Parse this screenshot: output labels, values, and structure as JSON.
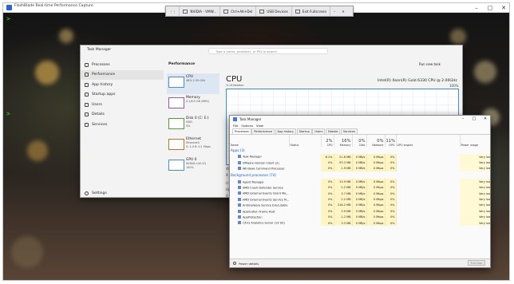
{
  "outer": {
    "title": "FlashBlade Real-time Performance Capture"
  },
  "vmbar": {
    "items": [
      "NVIDIA - VMW...",
      "Ctrl+Alt+Del",
      "USB Devices",
      "Exit Fullscreen"
    ]
  },
  "prompts": [
    ">",
    ">"
  ],
  "tm": {
    "title": "Task Manager",
    "search_placeholder": "Type a name, publisher, or PID to search",
    "nav": [
      {
        "label": "Processes",
        "icon": "grid-icon"
      },
      {
        "label": "Performance",
        "icon": "performance-icon"
      },
      {
        "label": "App history",
        "icon": "history-icon"
      },
      {
        "label": "Startup apps",
        "icon": "startup-icon"
      },
      {
        "label": "Users",
        "icon": "users-icon"
      },
      {
        "label": "Details",
        "icon": "details-icon"
      },
      {
        "label": "Services",
        "icon": "services-icon"
      }
    ],
    "settings": "Settings",
    "section": "Performance",
    "run_new_task": "Run new task",
    "cards": [
      {
        "name": "CPU",
        "sub": "46% 2.00 GHz"
      },
      {
        "name": "Memory",
        "sub": "4.1/6.0 GB (68%)"
      },
      {
        "name": "Disk 0 (C: E:)",
        "sub": "HDD\n0%"
      },
      {
        "name": "Ethernet",
        "sub": "Ethernet0\nS: 1.0 R: 0.1 Mbps"
      },
      {
        "name": "GPU 0",
        "sub": "NVIDIA L40-2Q\n100%"
      }
    ],
    "cpu_title": "CPU",
    "cpu_sub": "% Utilization",
    "cpu_name": "Intel(R) Xeon(R) Gold 6330 CPU @ 2.00GHz",
    "cpu_max": "100%",
    "side_stats": [
      "46",
      "9",
      "U",
      "Up",
      "0"
    ]
  },
  "tm2": {
    "title": "Task Manager",
    "menu": [
      "File",
      "Options",
      "View"
    ],
    "tabs": [
      "Processes",
      "Performance",
      "App history",
      "Startup",
      "Users",
      "Details",
      "Services"
    ],
    "columns": [
      {
        "label": "Name",
        "pct": ""
      },
      {
        "label": "Status",
        "pct": ""
      },
      {
        "label": "CPU",
        "pct": "2%"
      },
      {
        "label": "Memory",
        "pct": "16%"
      },
      {
        "label": "Disk",
        "pct": "0%"
      },
      {
        "label": "Network",
        "pct": "0%"
      },
      {
        "label": "GPU",
        "pct": "11%"
      },
      {
        "label": "GPU engine",
        "pct": ""
      },
      {
        "label": "Power usage",
        "pct": ""
      }
    ],
    "groups": [
      {
        "title": "Apps (3)",
        "rows": [
          {
            "name": "Task Manager",
            "cpu": "6.1%",
            "mem": "21.6 MB",
            "disk": "0 MB/s",
            "net": "0 Mbps",
            "gpu": "0%",
            "power": "Very low"
          },
          {
            "name": "VMware Horizon Client (2)",
            "cpu": "0%",
            "mem": "93.3 MB",
            "disk": "0 MB/s",
            "net": "0 Mbps",
            "gpu": "0%",
            "power": "Very low"
          },
          {
            "name": "Windows Command Processor",
            "cpu": "0%",
            "mem": "1.9 MB",
            "disk": "0 MB/s",
            "net": "0 Mbps",
            "gpu": "0%",
            "power": "Very low"
          }
        ]
      },
      {
        "title": "Background processes (74)",
        "rows": [
          {
            "name": "Agent Manager",
            "cpu": "0%",
            "mem": "13.9 MB",
            "disk": "0 MB/s",
            "net": "0 Mbps",
            "gpu": "0%",
            "power": "Very low"
          },
          {
            "name": "AMD Crash Defender Service",
            "cpu": "0%",
            "mem": "2.2 MB",
            "disk": "0 MB/s",
            "net": "0 Mbps",
            "gpu": "0%",
            "power": "Very low"
          },
          {
            "name": "AMD External Events Client Mo...",
            "cpu": "0%",
            "mem": "3.7 MB",
            "disk": "0 MB/s",
            "net": "0 Mbps",
            "gpu": "0%",
            "power": "Very low"
          },
          {
            "name": "AMD External Events Service M...",
            "cpu": "0%",
            "mem": "2.2 MB",
            "disk": "0 MB/s",
            "net": "0 Mbps",
            "gpu": "0%",
            "power": "Very low"
          },
          {
            "name": "Antimalware Service Executable",
            "cpu": "0%",
            "mem": "216.2 MB",
            "disk": "0 MB/s",
            "net": "0 Mbps",
            "gpu": "0%",
            "power": "Very low"
          },
          {
            "name": "Application Frame Host",
            "cpu": "0%",
            "mem": "3.9 MB",
            "disk": "0 MB/s",
            "net": "0 Mbps",
            "gpu": "0%",
            "power": "Very low"
          },
          {
            "name": "AppProtection",
            "cpu": "0%",
            "mem": "2.2 MB",
            "disk": "0 MB/s",
            "net": "0 Mbps",
            "gpu": "0%",
            "power": "Very low"
          },
          {
            "name": "Citrix Analytics Server (32 bit)",
            "cpu": "0%",
            "mem": "3.3 MB",
            "disk": "0 MB/s",
            "net": "0 Mbps",
            "gpu": "0%",
            "power": "Very low"
          }
        ]
      }
    ],
    "fewer_details": "Fewer details",
    "end_task": "End task"
  }
}
